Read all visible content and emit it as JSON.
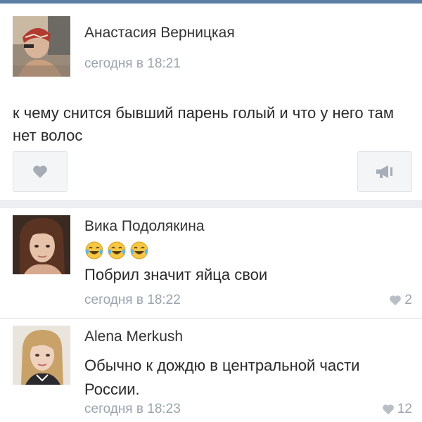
{
  "post": {
    "author": "Анастасия Верницкая",
    "time": "сегодня в 18:21",
    "text": "к чему снится бывший парень голый и что у него там нет волос"
  },
  "comments": [
    {
      "author": "Вика Подолякина",
      "emoji": [
        "face-with-tears-of-joy",
        "face-with-tears-of-joy",
        "face-with-tears-of-joy"
      ],
      "text": "Побрил значит яйца свои",
      "time": "сегодня в 18:22",
      "likes": "2"
    },
    {
      "author": "Alena Merkush",
      "text": "Обычно к дождю в центральной части России.",
      "time": "сегодня в 18:23",
      "likes": "12"
    }
  ],
  "colors": {
    "header_bar": "#5a7ea6",
    "meta_text": "#9aa3ad",
    "heart_gray": "#9aa3ad"
  }
}
